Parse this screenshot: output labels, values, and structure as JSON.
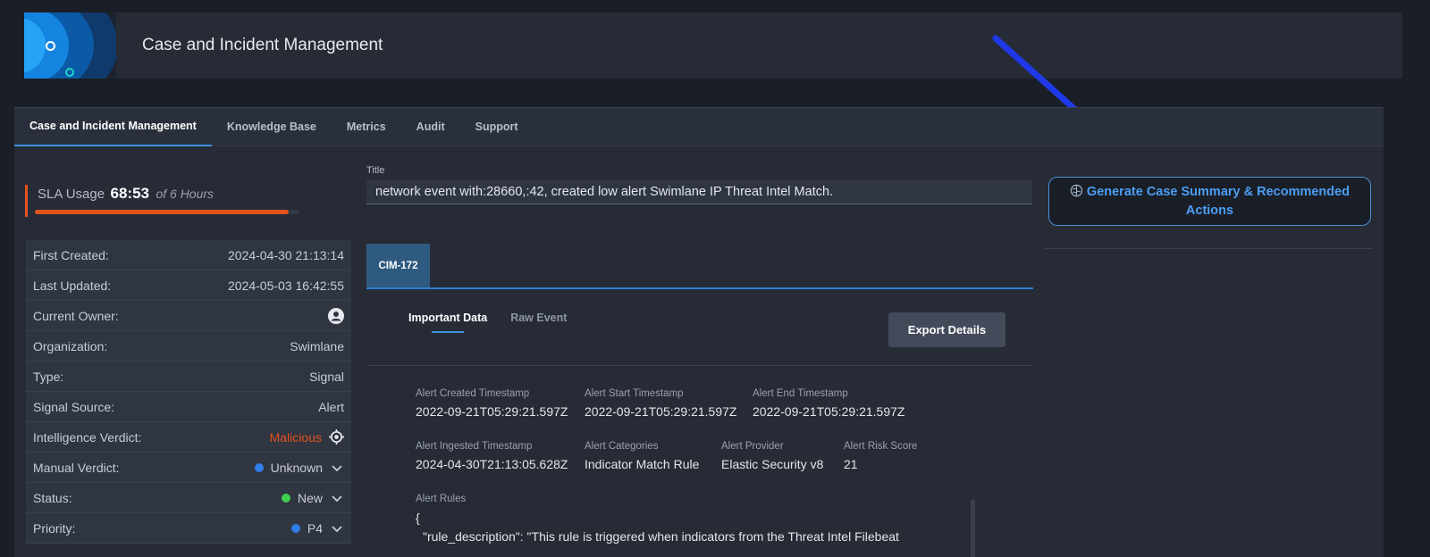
{
  "app": {
    "title": "Case and Incident Management"
  },
  "nav": {
    "tabs": [
      {
        "label": "Case and Incident Management"
      },
      {
        "label": "Knowledge Base"
      },
      {
        "label": "Metrics"
      },
      {
        "label": "Audit"
      },
      {
        "label": "Support"
      }
    ]
  },
  "sla": {
    "label": "SLA Usage",
    "value": "68:53",
    "of": "of 6 Hours",
    "fill_fraction": 0.96
  },
  "details": [
    {
      "label": "First Created:",
      "value": "2024-04-30 21:13:14"
    },
    {
      "label": "Last Updated:",
      "value": "2024-05-03 16:42:55"
    },
    {
      "label": "Current Owner:",
      "value": ""
    },
    {
      "label": "Organization:",
      "value": "Swimlane"
    },
    {
      "label": "Type:",
      "value": "Signal"
    },
    {
      "label": "Signal Source:",
      "value": "Alert"
    },
    {
      "label": "Intelligence Verdict:",
      "value": "Malicious"
    },
    {
      "label": "Manual Verdict:",
      "value": "Unknown"
    },
    {
      "label": "Status:",
      "value": "New"
    },
    {
      "label": "Priority:",
      "value": "P4"
    }
  ],
  "colors": {
    "accent": "#3d8fe0",
    "danger": "#e2521e",
    "status_new": "#3fce4f",
    "dot_blue": "#2f7fe8"
  },
  "title_field": {
    "label": "Title",
    "value": "network event with:28660,:42, created low alert Swimlane IP Threat Intel Match."
  },
  "case_tab": {
    "label": "CIM-172"
  },
  "subtabs": {
    "important": "Important Data",
    "raw": "Raw Event"
  },
  "export": {
    "label": "Export Details"
  },
  "fields": [
    {
      "label": "Alert Created Timestamp",
      "value": "2022-09-21T05:29:21.597Z"
    },
    {
      "label": "Alert Start Timestamp",
      "value": "2022-09-21T05:29:21.597Z"
    },
    {
      "label": "Alert End Timestamp",
      "value": "2022-09-21T05:29:21.597Z"
    },
    {
      "label": "Alert Ingested Timestamp",
      "value": "2024-04-30T21:13:05.628Z"
    },
    {
      "label": "Alert Categories",
      "value": "Indicator Match Rule"
    },
    {
      "label": "Alert Provider",
      "value": "Elastic Security v8"
    },
    {
      "label": "Alert Risk Score",
      "value": "21"
    }
  ],
  "alert_rules": {
    "label": "Alert Rules",
    "line1": "{",
    "line2": "\"rule_description\": \"This rule is triggered when indicators from the Threat Intel Filebeat"
  },
  "generate": {
    "label": "Generate Case Summary & Recommended Actions",
    "icon": "brain-icon"
  }
}
